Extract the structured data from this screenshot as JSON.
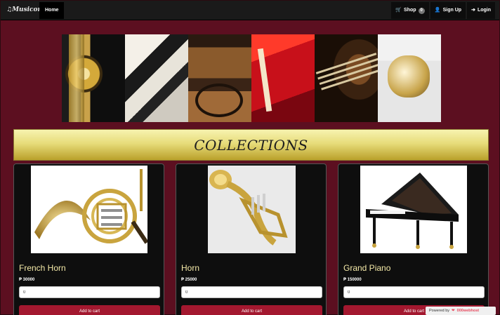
{
  "navbar": {
    "brand": "♫Musicore",
    "home": "Home",
    "shop": "Shop",
    "shop_count": "0",
    "signup": "Sign Up",
    "login": "Login"
  },
  "section_title": "COLLECTIONS",
  "products": [
    {
      "name": "French Horn",
      "price": "₱ 30000",
      "qty": "0",
      "button": "Add to cart"
    },
    {
      "name": "Horn",
      "price": "₱ 25000",
      "qty": "0",
      "button": "Add to cart"
    },
    {
      "name": "Grand Piano",
      "price": "₱ 150000",
      "qty": "0",
      "button": "Add to cart"
    }
  ],
  "powered_by": {
    "prefix": "Powered by",
    "brand": "000webhost"
  },
  "colors": {
    "background": "#5c0f20",
    "navbar": "#1a1a1a",
    "button": "#a3182f",
    "product_name": "#f4e9a8"
  }
}
